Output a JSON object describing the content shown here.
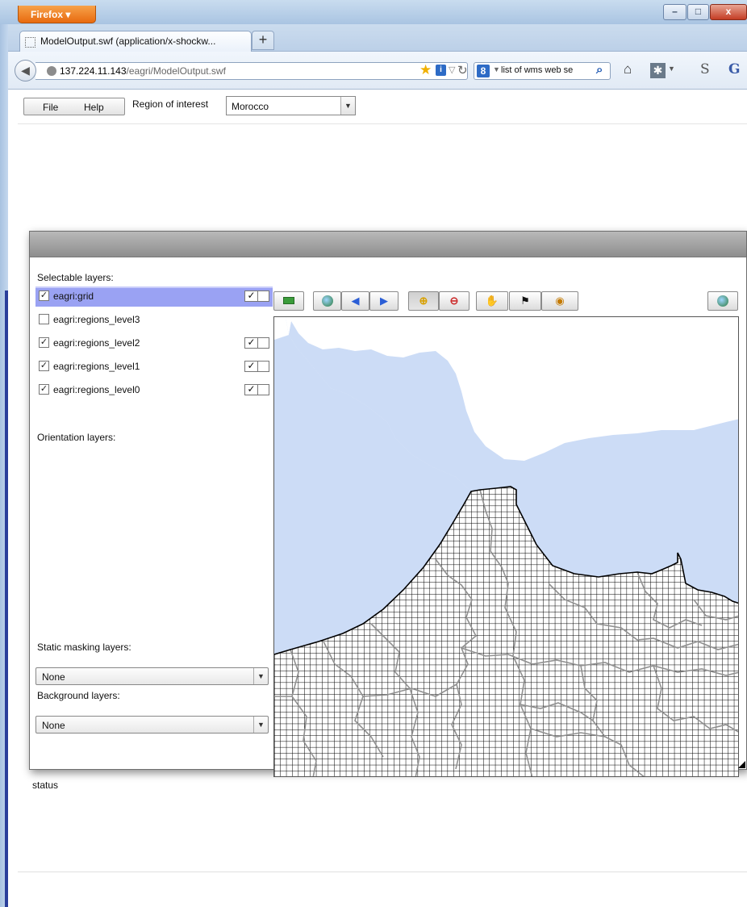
{
  "browser": {
    "menu_button": "Firefox ▾",
    "tab_title": "ModelOutput.swf (application/x-shockw...",
    "new_tab": "+",
    "url_host": "137.224.11.143",
    "url_path": "/eagri/ModelOutput.swf",
    "search_text": "list of wms web se",
    "window_controls": {
      "minimize": "–",
      "maximize": "□",
      "close": "x"
    },
    "icons": [
      "back-arrow-icon",
      "globe-icon",
      "star-icon",
      "info-icon",
      "reload-icon",
      "search-engine-icon",
      "magnifier-icon",
      "home-icon",
      "addon-icon",
      "s-icon",
      "gmail-icon"
    ]
  },
  "app": {
    "menu": {
      "file": "File",
      "help": "Help"
    },
    "region_label": "Region of interest",
    "region_value": "Morocco"
  },
  "layer_window": {
    "selectable_label": "Selectable layers:",
    "layers": [
      {
        "name": "eagri:grid",
        "checked": true,
        "selected": true,
        "toggle": true
      },
      {
        "name": "eagri:regions_level3",
        "checked": false,
        "selected": false,
        "toggle": false
      },
      {
        "name": "eagri:regions_level2",
        "checked": true,
        "selected": false,
        "toggle": true
      },
      {
        "name": "eagri:regions_level1",
        "checked": true,
        "selected": false,
        "toggle": true
      },
      {
        "name": "eagri:regions_level0",
        "checked": true,
        "selected": false,
        "toggle": true
      }
    ],
    "orientation_label": "Orientation layers:",
    "masking_label": "Static masking layers:",
    "masking_value": "None",
    "background_label": "Background layers:",
    "background_value": "None",
    "status": "status",
    "map_tools": [
      "zoom-full-extent-icon",
      "globe-icon",
      "previous-extent-icon",
      "next-extent-icon",
      "zoom-in-icon",
      "zoom-out-icon",
      "pan-hand-icon",
      "identify-icon",
      "measure-icon",
      "wms-globe-icon"
    ]
  },
  "colors": {
    "sea": "#ccdcf6",
    "grid": "#000000",
    "region_lines": "#909090",
    "selected_row": "#9aa2f3"
  }
}
